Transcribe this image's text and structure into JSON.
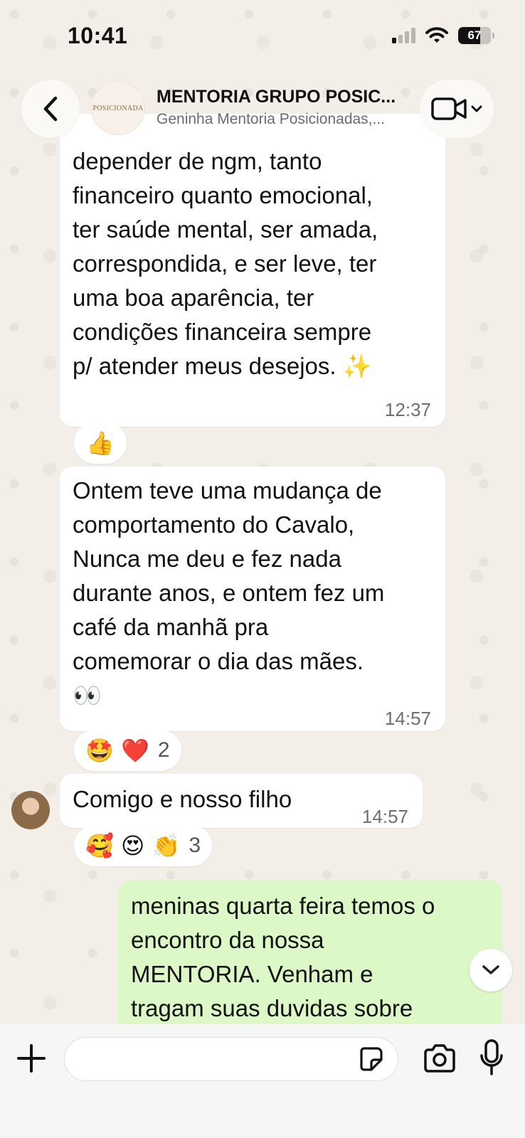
{
  "status_bar": {
    "time": "10:41",
    "battery": "67"
  },
  "header": {
    "title": "MENTORIA GRUPO POSIC...",
    "subtitle": "Geninha Mentoria Posicionadas,...",
    "group_logo_text": "POSICIONADA"
  },
  "messages": [
    {
      "lines": [
        "depender de ngm, tanto",
        "financeiro quanto emocional,",
        "ter saúde mental, ser amada,",
        "correspondida, e ser leve, ter",
        "uma boa aparência, ter",
        "condições financeira sempre",
        "p/ atender meus desejos. ✨"
      ],
      "time": "12:37"
    },
    {
      "lines": [
        "Ontem teve uma mudança de",
        "comportamento do Cavalo,",
        "Nunca me deu e fez nada",
        "durante anos, e ontem fez um",
        "café da manhã pra",
        "comemorar o dia das mães.",
        "👀"
      ],
      "time": "14:57"
    },
    {
      "lines": [
        "Comigo e nosso filho"
      ],
      "time": "14:57"
    },
    {
      "lines": [
        "meninas quarta feira temos o",
        "encontro da nossa",
        "MENTORIA.  Venham e",
        "tragam suas duvidas sobre"
      ]
    }
  ],
  "reactions": [
    {
      "emojis": "👍",
      "count": ""
    },
    {
      "emojis": "🤩 ❤️",
      "count": "2"
    },
    {
      "emojis": "🥰 😍 👏",
      "count": "3"
    }
  ],
  "input": {
    "placeholder": ""
  }
}
